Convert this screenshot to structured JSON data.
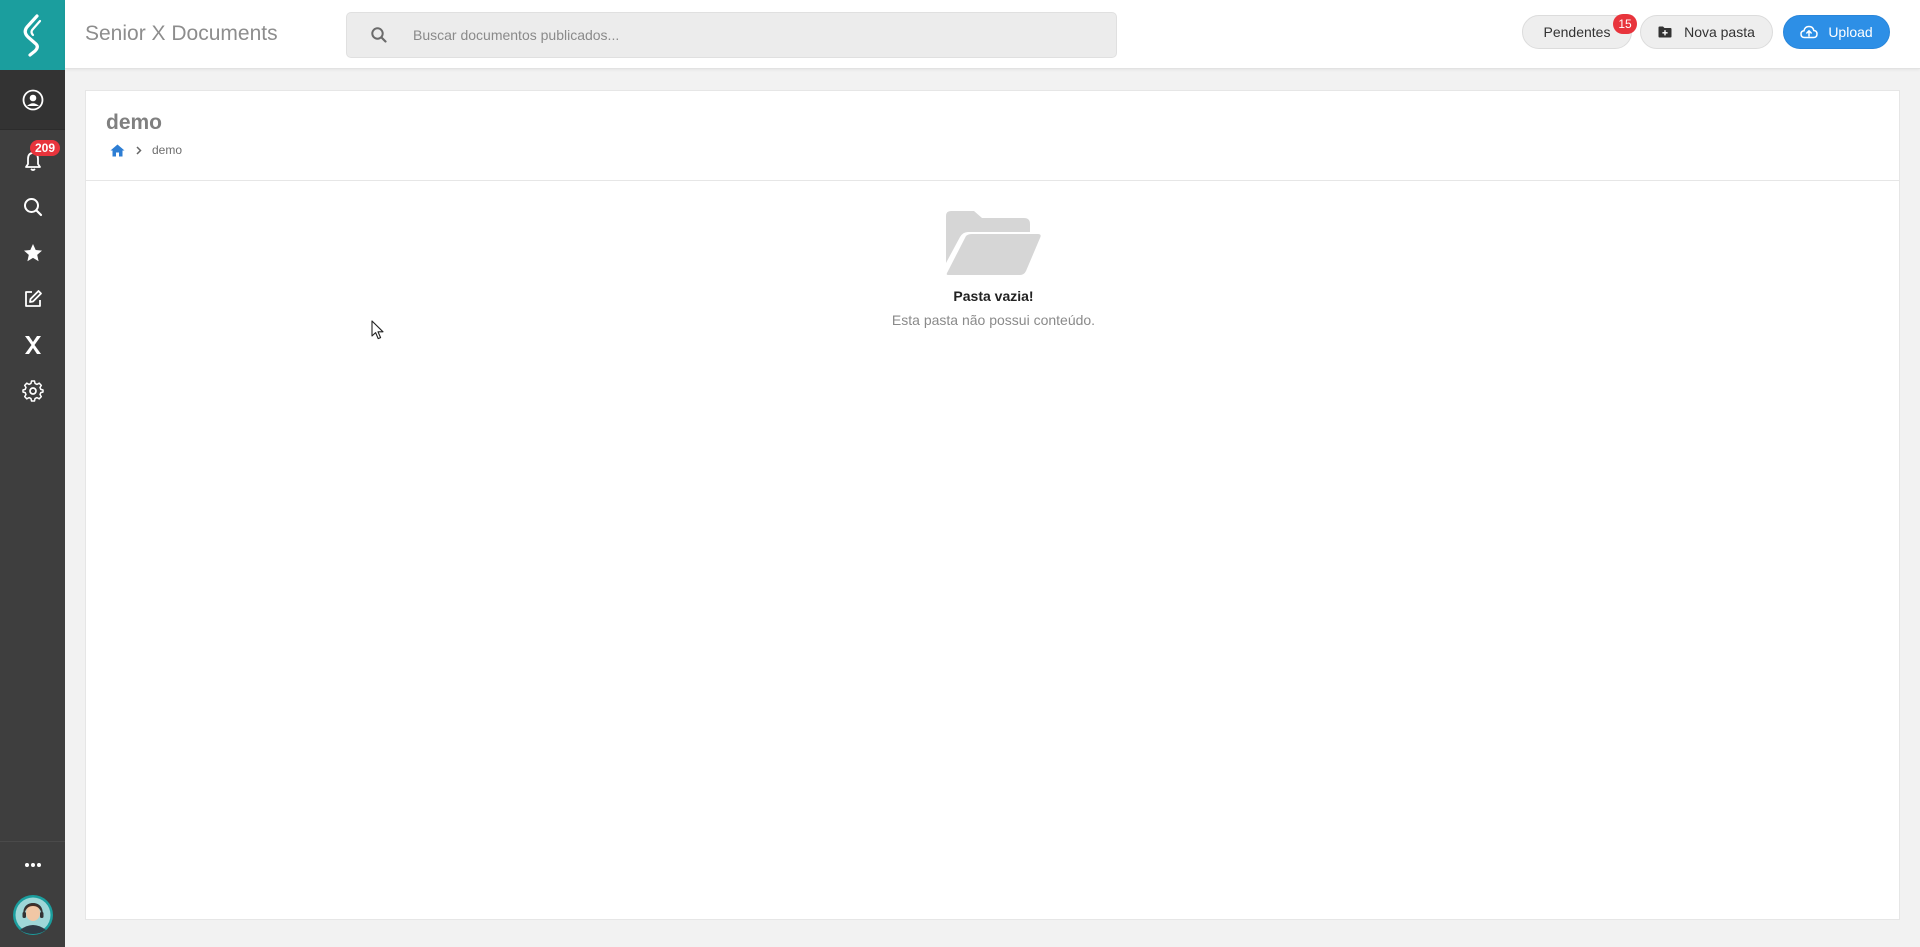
{
  "app": {
    "title": "Senior X Documents"
  },
  "sidebar": {
    "notifications_count": "209",
    "items": [
      {
        "name": "user-icon"
      },
      {
        "name": "bell-icon"
      },
      {
        "name": "search-icon"
      },
      {
        "name": "star-icon"
      },
      {
        "name": "edit-icon"
      },
      {
        "name": "x-logo-icon"
      },
      {
        "name": "gear-icon"
      },
      {
        "name": "more-icon"
      }
    ]
  },
  "header": {
    "search_placeholder": "Buscar documentos publicados...",
    "pendentes_label": "Pendentes",
    "pendentes_count": "15",
    "nova_pasta_label": "Nova pasta",
    "upload_label": "Upload"
  },
  "page": {
    "title": "demo",
    "breadcrumb": [
      "demo"
    ]
  },
  "empty_state": {
    "title": "Pasta vazia!",
    "message": "Esta pasta não possui conteúdo."
  },
  "colors": {
    "sidebar_bg": "#3e3e3e",
    "logo_bg": "#1b9e9e",
    "badge_red": "#e8343c",
    "upload_blue": "#2d8fe6"
  }
}
